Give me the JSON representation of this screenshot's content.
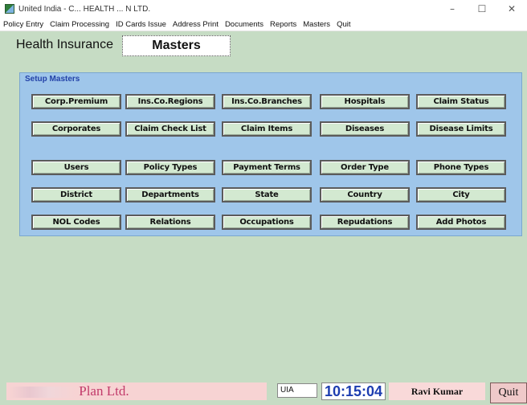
{
  "window": {
    "title": "United India - C... HEALTH ... N LTD.",
    "controls": {
      "minimize": "–",
      "maximize": "☐",
      "close": "✕"
    }
  },
  "menu": [
    "Policy Entry",
    "Claim Processing",
    "ID Cards Issue",
    "Address Print",
    "Documents",
    "Reports",
    "Masters",
    "Quit"
  ],
  "header": {
    "module": "Health Insurance",
    "active_tab": "Masters"
  },
  "setup_masters": {
    "title": "Setup Masters",
    "rows": [
      [
        "Corp.Premium",
        "Ins.Co.Regions",
        "Ins.Co.Branches",
        "Hospitals",
        "Claim Status"
      ],
      [
        "Corporates",
        "Claim Check List",
        "Claim Items",
        "Diseases",
        "Disease Limits"
      ],
      [
        "Users",
        "Policy Types",
        "Payment Terms",
        "Order Type",
        "Phone Types"
      ],
      [
        "District",
        "Departments",
        "State",
        "Country",
        "City"
      ],
      [
        "NOL Codes",
        "Relations",
        "Occupations",
        "Repudations",
        "Add Photos"
      ]
    ]
  },
  "status": {
    "brand_suffix": "Plan Ltd.",
    "user_code": "UIA",
    "time": "10:15:04",
    "user_name": "Ravi Kumar",
    "quit_label": "Quit"
  },
  "colors": {
    "background": "#c6dcc4",
    "group_bg": "#9fc6ea",
    "group_title": "#2342a8",
    "button_bg": "#d3e9d1",
    "clock": "#1d3db0",
    "brand": "#c23a6a"
  }
}
